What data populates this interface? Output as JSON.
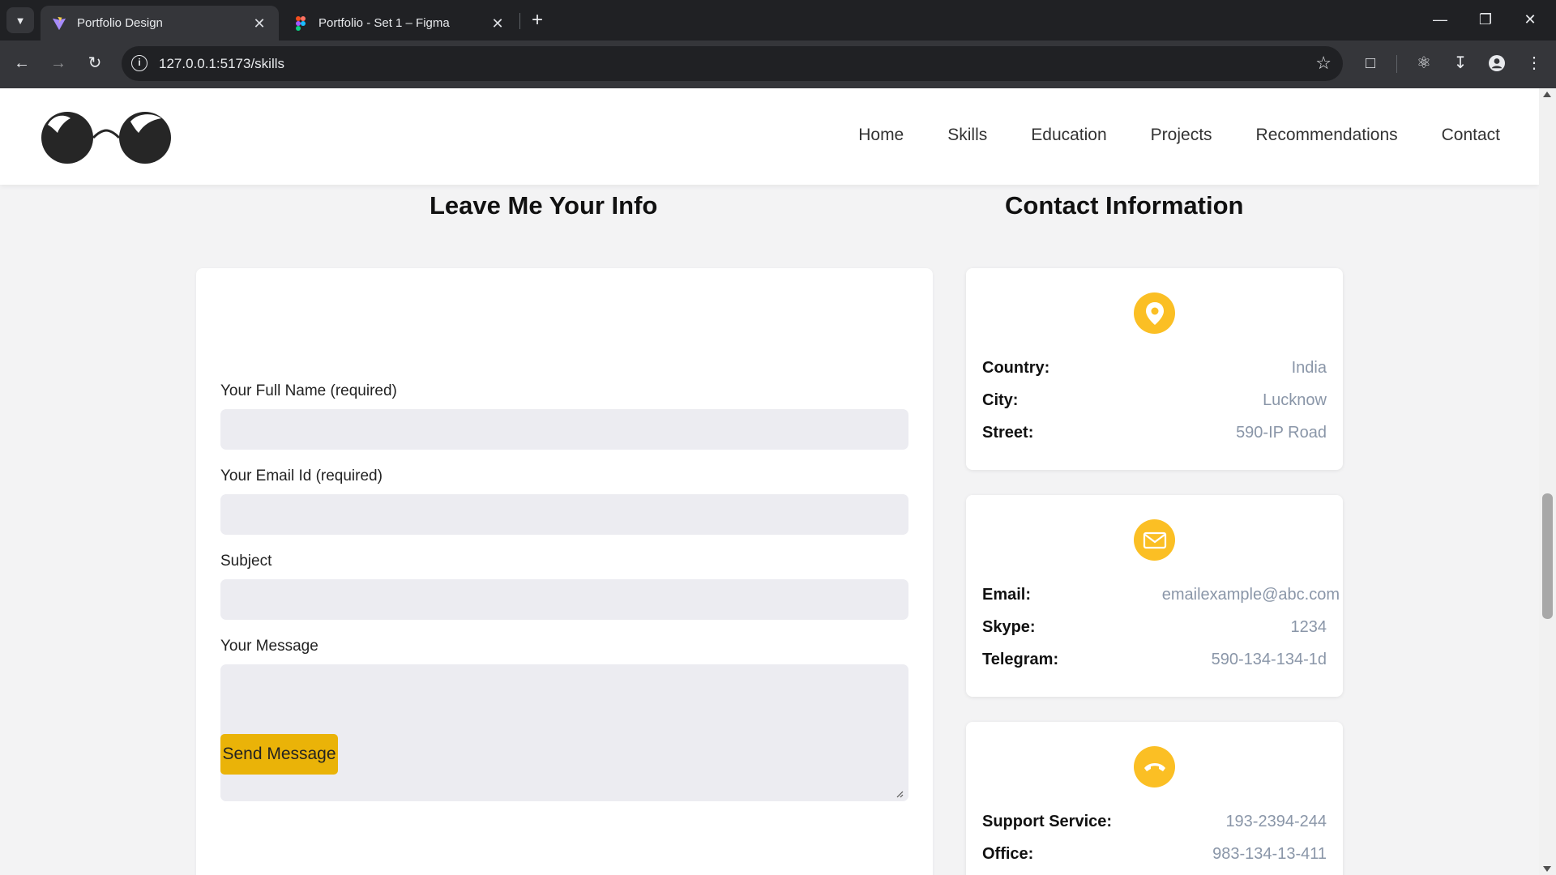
{
  "browser": {
    "tabs": [
      {
        "title": "Portfolio Design",
        "active": true
      },
      {
        "title": "Portfolio - Set 1 – Figma",
        "active": false
      }
    ],
    "url": "127.0.0.1:5173/skills"
  },
  "nav": {
    "items": [
      "Home",
      "Skills",
      "Education",
      "Projects",
      "Recommendations",
      "Contact"
    ]
  },
  "form_section": {
    "title": "Leave Me Your Info",
    "fields": [
      {
        "label": "Your Full Name (required)",
        "value": "",
        "placeholder": ""
      },
      {
        "label": "Your Email Id (required)",
        "value": "",
        "placeholder": ""
      },
      {
        "label": "Subject",
        "value": "",
        "placeholder": ""
      },
      {
        "label": "Your Message",
        "value": "",
        "placeholder": ""
      }
    ],
    "submit_label": "Send Message"
  },
  "contact_section": {
    "title": "Contact Information",
    "cards": [
      {
        "icon": "location-pin-icon",
        "rows": [
          {
            "key": "Country:",
            "value": "India"
          },
          {
            "key": "City:",
            "value": "Lucknow"
          },
          {
            "key": "Street:",
            "value": "590-IP Road"
          }
        ]
      },
      {
        "icon": "mail-icon",
        "rows": [
          {
            "key": "Email:",
            "value": "emailexample@abc.com"
          },
          {
            "key": "Skype:",
            "value": "1234"
          },
          {
            "key": "Telegram:",
            "value": "590-134-134-1d"
          }
        ]
      },
      {
        "icon": "phone-icon",
        "rows": [
          {
            "key": "Support Service:",
            "value": "193-2394-244"
          },
          {
            "key": "Office:",
            "value": "983-134-13-411"
          }
        ]
      }
    ]
  },
  "colors": {
    "accent": "#fbbf24",
    "button": "#eab308",
    "muted_value": "#8a96a8",
    "page_bg": "#f3f3f4",
    "input_bg": "#ececf1"
  }
}
